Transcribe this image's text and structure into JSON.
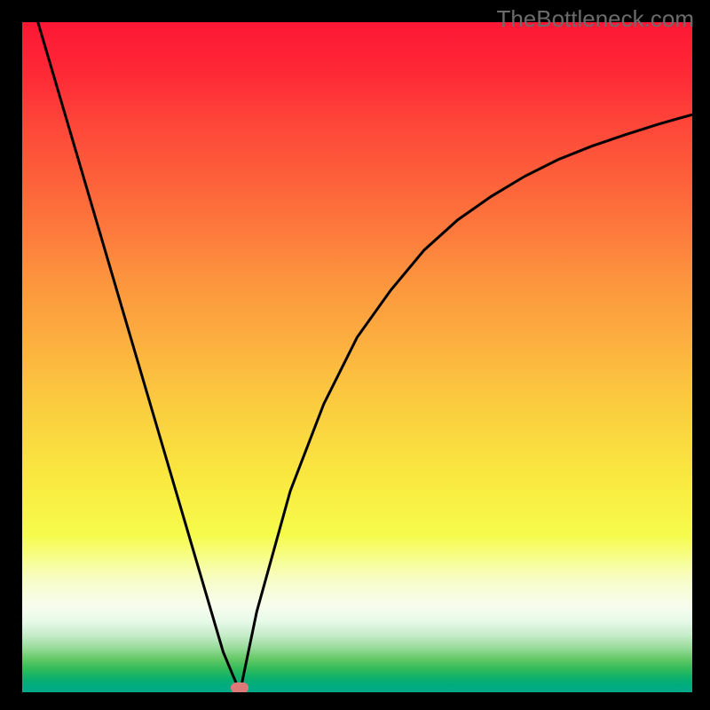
{
  "watermark": "TheBottleneck.com",
  "chart_data": {
    "type": "line",
    "title": "",
    "xlabel": "",
    "ylabel": "",
    "x_range": [
      0,
      100
    ],
    "y_range": [
      0,
      100
    ],
    "series": [
      {
        "name": "bottleneck-curve",
        "x": [
          0,
          5,
          10,
          15,
          20,
          25,
          30,
          32.5,
          35,
          40,
          45,
          50,
          55,
          60,
          65,
          70,
          75,
          80,
          85,
          90,
          95,
          100
        ],
        "values": [
          108,
          91,
          74,
          57,
          40,
          23,
          6,
          0,
          12,
          30,
          43,
          53,
          60,
          66,
          70.5,
          74,
          77,
          79.5,
          81.5,
          83.2,
          84.8,
          86.2
        ]
      }
    ],
    "marker": {
      "x_pct": 32.5,
      "y_pct": 0.7,
      "color": "#df7977",
      "label": "optimal-point"
    },
    "background_gradient": {
      "top": "#fe1735",
      "mid": "#fad93f",
      "bottom": "#00aa89"
    },
    "grid": false,
    "legend": false
  },
  "colors": {
    "frame": "#000000",
    "curve": "#000000",
    "marker": "#df7977",
    "watermark": "#6b6b6b"
  }
}
